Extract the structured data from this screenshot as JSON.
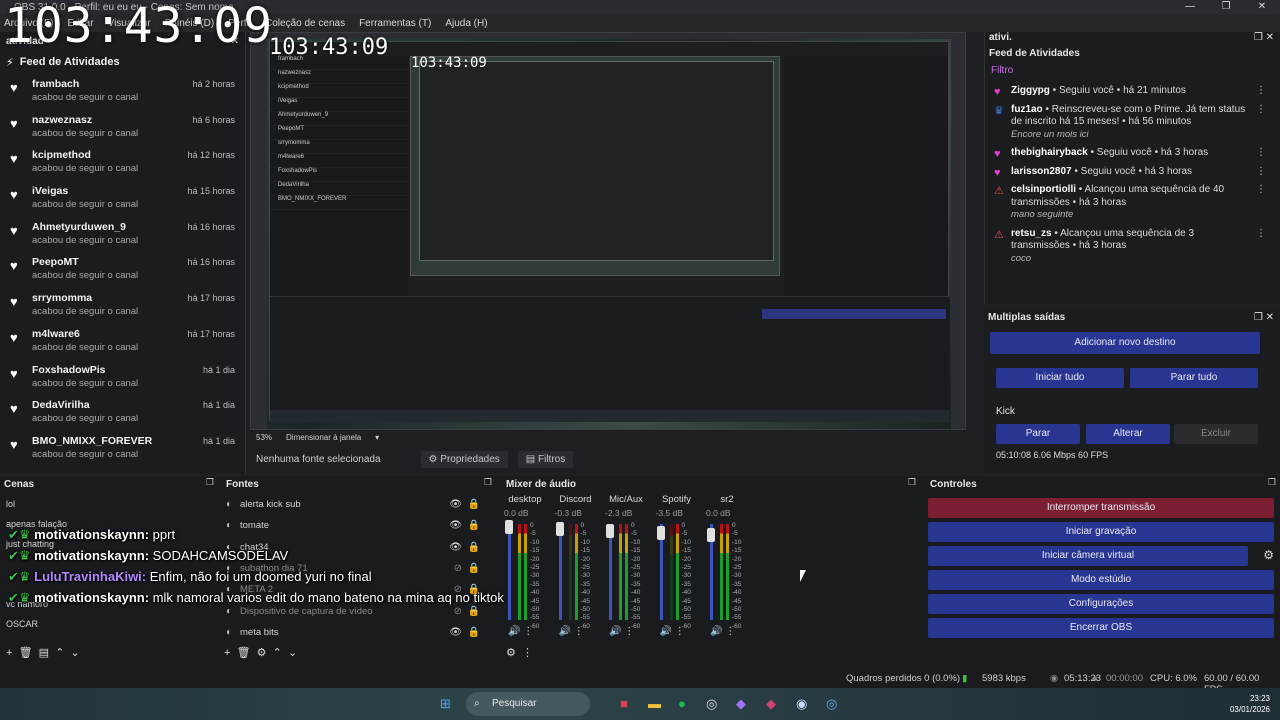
{
  "window": {
    "title": "OBS 31.0.0 - Perfil: eu eu eu - Cenas: Sem nome",
    "controls": [
      "—",
      "❐",
      "✕"
    ]
  },
  "menu": [
    "Arquivo (F)",
    "Editar",
    "Visualizar",
    "Painéis (D)",
    "Perfil",
    "Coleção de cenas",
    "Ferramentas (T)",
    "Ajuda (H)"
  ],
  "overlay": {
    "clock_big": "103:43:09",
    "clock_mid": "103:43:09",
    "clock_small": "103:43:09",
    "chat": [
      {
        "user": "motivationskaynn:",
        "msg": "pprt",
        "color": "white"
      },
      {
        "user": "motivationskaynn:",
        "msg": "SODAHCAMSODELAV",
        "color": "white"
      },
      {
        "user": "LuluTravinhaKiwi:",
        "msg": "Enfim, não foi um doomed yuri no final",
        "color": "purple"
      },
      {
        "user": "motivationskaynn:",
        "msg": "mlk namoral varios edit do mano bateno na mina aq no tiktok",
        "color": "white"
      }
    ]
  },
  "activity_left": {
    "dock_title": "atividad",
    "header": "Feed de Atividades",
    "items": [
      {
        "user": "frambach",
        "action": "acabou de seguir o canal",
        "when": "há 2 horas"
      },
      {
        "user": "nazweznasz",
        "action": "acabou de seguir o canal",
        "when": "há 6 horas"
      },
      {
        "user": "kcipmethod",
        "action": "acabou de seguir o canal",
        "when": "há 12 horas"
      },
      {
        "user": "iVeigas",
        "action": "acabou de seguir o canal",
        "when": "há 15 horas"
      },
      {
        "user": "Ahmetyurduwen_9",
        "action": "acabou de seguir o canal",
        "when": "há 16 horas"
      },
      {
        "user": "PeepoMT",
        "action": "acabou de seguir o canal",
        "when": "há 16 horas"
      },
      {
        "user": "srrymomma",
        "action": "acabou de seguir o canal",
        "when": "há 17 horas"
      },
      {
        "user": "m4lware6",
        "action": "acabou de seguir o canal",
        "when": "há 17 horas"
      },
      {
        "user": "FoxshadowPis",
        "action": "acabou de seguir o canal",
        "when": "há 1 dia"
      },
      {
        "user": "DedaVirilha",
        "action": "acabou de seguir o canal",
        "when": "há 1 dia"
      },
      {
        "user": "BMO_NMIXX_FOREVER",
        "action": "acabou de seguir o canal",
        "when": "há 1 dia"
      }
    ]
  },
  "preview": {
    "zoom": "53%",
    "zoom_mode": "Dimensionar à janela",
    "no_source": "Nenhuma fonte selecionada",
    "properties_btn": "Propriedades",
    "filters_btn": "Filtros",
    "mini_feed": [
      "frambach",
      "nazweznasz",
      "kcipmethod",
      "iVeigas",
      "Ahmetyurduwen_9",
      "PeepoMT",
      "srrymomma",
      "m4lware6",
      "FoxshadowPis",
      "DedaVirilha",
      "BMO_NMIXX_FOREVER"
    ]
  },
  "activity_right": {
    "dock_title": "ativi.",
    "header": "Feed de Atividades",
    "filter": "Filtro",
    "items": [
      {
        "icon": "heart",
        "color": "#e040c8",
        "user": "Ziggypg",
        "text": "Seguiu você",
        "when": "há 21 minutos",
        "note": ""
      },
      {
        "icon": "prime",
        "color": "#3a7bd5",
        "user": "fuz1ao",
        "text": "Reinscreveu-se com o Prime. Já tem status de inscrito há 15 meses!",
        "when": "há 56 minutos",
        "note": "Encore un mois ici"
      },
      {
        "icon": "heart",
        "color": "#e040c8",
        "user": "thebighairyback",
        "text": "Seguiu você",
        "when": "há 3 horas",
        "note": ""
      },
      {
        "icon": "heart",
        "color": "#e040c8",
        "user": "larisson2807",
        "text": "Seguiu você",
        "when": "há 3 horas",
        "note": ""
      },
      {
        "icon": "streak",
        "color": "#e05050",
        "user": "celsinportiolli",
        "text": "Alcançou uma sequência de 40 transmissões",
        "when": "há 3 horas",
        "note": "mano seguinte"
      },
      {
        "icon": "streak",
        "color": "#e05050",
        "user": "retsu_zs",
        "text": "Alcançou uma sequência de 3 transmissões",
        "when": "há 3 horas",
        "note": "coco"
      }
    ]
  },
  "multi": {
    "title": "Multiplas saídas",
    "add": "Adicionar novo destino",
    "start_all": "Iniciar tudo",
    "stop_all": "Parar tudo",
    "target": "Kick",
    "stop": "Parar",
    "edit": "Alterar",
    "delete": "Excluir",
    "stats": "05:10:08  6.06 Mbps  60 FPS"
  },
  "scenes": {
    "title": "Cenas",
    "items": [
      "lol",
      "apenas falação",
      "just chatting",
      "",
      "",
      "vc namoro",
      "OSCAR"
    ]
  },
  "sources": {
    "title": "Fontes",
    "items": [
      {
        "name": "alerta kick sub",
        "visible": true
      },
      {
        "name": "tomate",
        "visible": true
      },
      {
        "name": "chat34",
        "visible": true
      },
      {
        "name": "subathon dia 71",
        "visible": false
      },
      {
        "name": "META 2",
        "visible": false
      },
      {
        "name": "Dispositivo de captura de vídeo",
        "visible": false
      },
      {
        "name": "meta bits",
        "visible": true
      }
    ]
  },
  "mixer": {
    "title": "Mixer de áudio",
    "channels": [
      {
        "name": "desktop",
        "db": "0.0 dB"
      },
      {
        "name": "Discord",
        "db": "-0.3 dB"
      },
      {
        "name": "Mic/Aux",
        "db": "-2.3 dB"
      },
      {
        "name": "Spotify",
        "db": "-3.5 dB"
      },
      {
        "name": "sr2",
        "db": "0.0 dB"
      }
    ],
    "scale": [
      "0",
      "-5",
      "-10",
      "-15",
      "-20",
      "-25",
      "-30",
      "-35",
      "-40",
      "-45",
      "-50",
      "-55",
      "-60"
    ]
  },
  "controls": {
    "title": "Controles",
    "stop_stream": "Interromper transmissão",
    "start_rec": "Iniciar gravação",
    "start_vcam": "Iniciar câmera virtual",
    "studio": "Modo estúdio",
    "settings": "Configurações",
    "exit": "Encerrar OBS"
  },
  "status": {
    "dropped": "Quadros perdidos 0 (0.0%)",
    "kbps": "5983 kbps",
    "stream_time": "05:13:23",
    "rec_time": "00:00:00",
    "cpu": "CPU: 6.0%",
    "fps": "60.00 / 60.00 FPS"
  },
  "taskbar": {
    "search": "Pesquisar",
    "time": "23:23",
    "date": "03/01/2026"
  }
}
